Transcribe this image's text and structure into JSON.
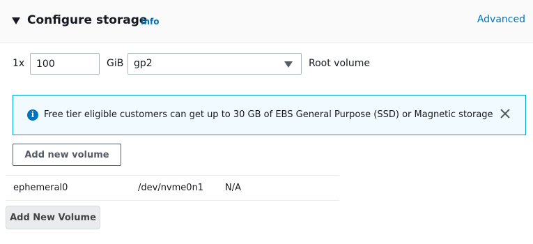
{
  "section": {
    "title": "Configure storage",
    "info_link": "Info",
    "advanced_link": "Advanced"
  },
  "root_volume": {
    "count_label": "1x",
    "size_value": "100",
    "unit_label": "GiB",
    "volume_type": "gp2",
    "volume_label": "Root volume"
  },
  "alert": {
    "icon": "info-icon",
    "icon_glyph": "i",
    "message": "Free tier eligible customers can get up to 30 GB of EBS General Purpose (SSD) or Magnetic storage",
    "close_icon": "close-icon"
  },
  "add_volume_button": "Add new volume",
  "instance_store": [
    {
      "name": "ephemeral0",
      "device": "/dev/nvme0n1",
      "size": "N/A"
    }
  ],
  "add_new_volume_button": "Add New Volume",
  "colors": {
    "link": "#0073bb",
    "alert_border": "#00a1c9",
    "alert_background": "#f1faff"
  }
}
